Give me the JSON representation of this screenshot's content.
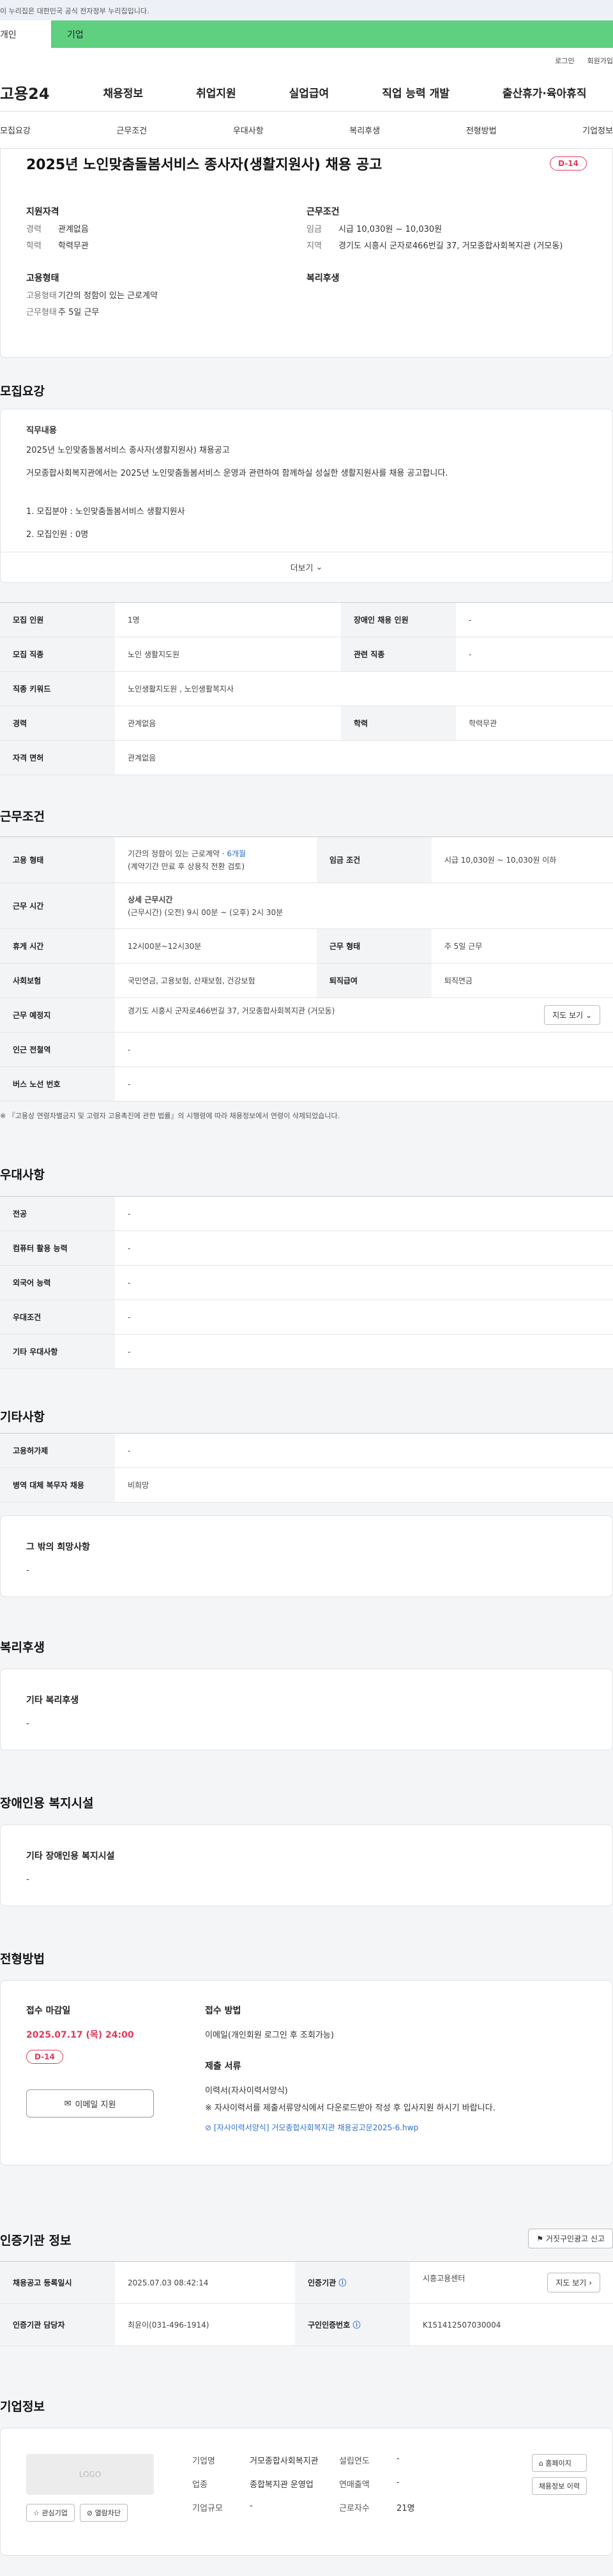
{
  "gov_bar": "이 누리집은 대한민국 공식 전자정부 누리집입니다.",
  "tabs": {
    "person": "개인",
    "corp": "기업"
  },
  "util": {
    "login": "로그인",
    "signup": "회원가입"
  },
  "gnb": {
    "logo": "고용24",
    "items": [
      "채용정보",
      "취업지원",
      "실업급여",
      "직업 능력 개발",
      "출산휴가·육아휴직"
    ]
  },
  "anchors": [
    "모집요강",
    "근무조건",
    "우대사항",
    "복리후생",
    "전형방법",
    "기업정보"
  ],
  "summary": {
    "title": "2025년 노인맞춤돌봄서비스 종사자(생활지원사) 채용 공고",
    "dday": "D-14",
    "qualification": {
      "heading": "지원자격",
      "career_k": "경력",
      "career_v": "관계없음",
      "edu_k": "학력",
      "edu_v": "학력무관"
    },
    "conditions": {
      "heading": "근무조건",
      "wage_k": "임금",
      "wage_v": "시급 10,030원 ~ 10,030원",
      "area_k": "지역",
      "area_v": "경기도 시흥시 군자로466번길 37, 거모종합사회복지관 (거모동)"
    },
    "employment": {
      "heading": "고용형태",
      "type_k": "고용형태",
      "type_v": "기간의 정함이 있는 근로계약",
      "form_k": "근무형태",
      "form_v": "주 5일 근무"
    },
    "welfare": {
      "heading": "복리후생"
    }
  },
  "recruit": {
    "section_title": "모집요강",
    "duty_heading": "직무내용",
    "duty_line1": "2025년 노인맞춤돌봄서비스 종사자(생활지원사) 채용공고",
    "duty_line2": "거모종합사회복지관에서는 2025년 노인맞춤돌봄서비스 운영과 관련하여 함께하실 성실한 생활지원사를 채용 공고합니다.",
    "duty_line3": "1. 모집분야 : 노인맞춤돌봄서비스 생활지원사",
    "duty_line4": "2. 모집인원 : 0명",
    "more": "더보기",
    "rows": [
      [
        "모집 인원",
        "1명",
        "장애인 채용 인원",
        "-"
      ],
      [
        "모집 직종",
        "노인 생활지도원",
        "관련 직종",
        "-"
      ],
      [
        "직종 키워드",
        "노인생활지도원 , 노인생활복지사",
        "",
        ""
      ],
      [
        "경력",
        "관계없음",
        "학력",
        "학력무관"
      ],
      [
        "자격 면허",
        "관계없음",
        "",
        ""
      ]
    ]
  },
  "work": {
    "section_title": "근무조건",
    "type_k": "고용 형태",
    "type_v1": "기간의 정함이 있는 근로계약 · ",
    "type_months": "6개월",
    "type_v2": "(계약기간 만료 후 상용직 전환 검토)",
    "wage_k": "임금 조건",
    "wage_v": "시급 10,030원 ~ 10,030원 이하",
    "hours_k": "근무 시간",
    "hours_h": "상세 근무시간",
    "hours_v": "(근무시간) (오전) 9시 00분 ~ (오후) 2시 30분",
    "rest_k": "휴게 시간",
    "rest_v": "12시00분~12시30분",
    "form_k": "근무 형태",
    "form_v": "주 5일 근무",
    "ins_k": "사회보험",
    "ins_v": "국민연금, 고용보험, 산재보험, 건강보험",
    "sev_k": "퇴직급여",
    "sev_v": "퇴직연금",
    "place_k": "근무 예정지",
    "place_v": "경기도 시흥시 군자로466번길 37, 거모종합사회복지관 (거모동)",
    "map_btn": "지도 보기",
    "subway_k": "인근 전철역",
    "subway_v": "-",
    "bus_k": "버스 노선 번호",
    "bus_v": "-",
    "note": "『고용상 연령차별금지 및 고령자 고용촉진에 관한 법률』의 시행령에 따라 채용정보에서 연령이 삭제되었습니다."
  },
  "prefer": {
    "section_title": "우대사항",
    "rows": [
      [
        "전공",
        "-"
      ],
      [
        "컴퓨터 활용 능력",
        "-"
      ],
      [
        "외국어 능력",
        "-"
      ],
      [
        "우대조건",
        "-"
      ],
      [
        "기타 우대사항",
        "-"
      ]
    ]
  },
  "etc": {
    "section_title": "기타사항",
    "rows": [
      [
        "고용허가제",
        "-"
      ],
      [
        "병역 대체 복무자 채용",
        "비희망"
      ]
    ],
    "hope_h": "그 밖의 희망사항",
    "hope_v": "-"
  },
  "welfare": {
    "section_title": "복리후생",
    "h": "기타 복리후생",
    "v": "-"
  },
  "disabled": {
    "section_title": "장애인용 복지시설",
    "h": "기타 장애인용 복지시설",
    "v": "-"
  },
  "apply": {
    "section_title": "전형방법",
    "deadline_h": "접수 마감일",
    "deadline_v": "2025.07.17 (목) 24:00",
    "dday": "D-14",
    "email_btn": "이메일 지원",
    "method_h": "접수 방법",
    "method_v": "이메일(개인회원 로그인 후 조회가능)",
    "docs_h": "제출 서류",
    "docs_v1": "이력서(자사이력서양식)",
    "docs_v2": "※ 자사이력서를 제출서류양식에서 다운로드받아 작성 후 입사지원 하시기 바랍니다.",
    "file": "[자사이력서양식] 거모종합사회복지관 채용공고문2025-6.hwp"
  },
  "cert": {
    "section_title": "인증기관 정보",
    "report_btn": "거짓구인광고 신고",
    "reg_k": "채용공고 등록일시",
    "reg_v": "2025.07.03 08:42:14",
    "org_k": "인증기관",
    "org_v": "시흥고용센터",
    "map_btn": "지도 보기",
    "mgr_k": "인증기관 담당자",
    "mgr_v": "최윤이(031-496-1914)",
    "num_k": "구인인증번호",
    "num_v": "K151412507030004"
  },
  "corp": {
    "section_title": "기업정보",
    "logo": "LOGO",
    "fav_btn": "관심기업",
    "block_btn": "열람차단",
    "name_k": "기업명",
    "name_v": "거모종합사회복지관",
    "industry_k": "업종",
    "industry_v": "종합복지관 운영업",
    "scale_k": "기업규모",
    "scale_v": "-",
    "founded_k": "설립연도",
    "founded_v": "-",
    "sales_k": "연매출액",
    "sales_v": "-",
    "staff_k": "근로자수",
    "staff_v": "21명",
    "home_btn": "홈페이지",
    "jobs_btn": "채용정보 이력"
  }
}
